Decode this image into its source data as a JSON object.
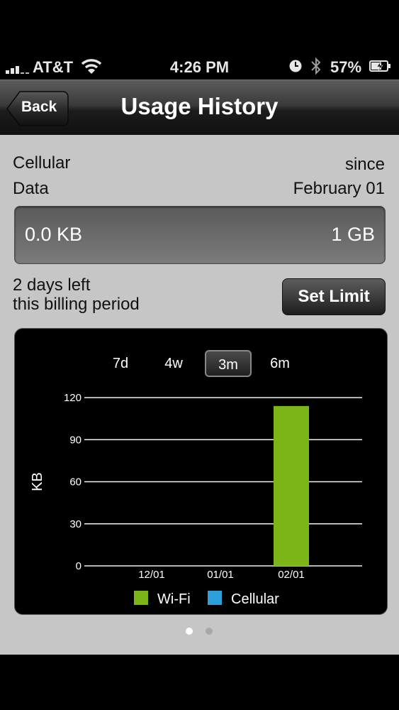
{
  "status_bar": {
    "carrier": "AT&T",
    "time": "4:26 PM",
    "battery": "57%"
  },
  "nav": {
    "back_label": "Back",
    "title": "Usage History"
  },
  "usage": {
    "type_line1": "Cellular",
    "type_line2": "Data",
    "since_line1": "since",
    "since_line2": "February 01",
    "used": "0.0 KB",
    "limit": "1 GB",
    "used_fraction": 0,
    "days_left_line1": "2 days left",
    "days_left_line2": "this billing period",
    "set_limit_label": "Set Limit"
  },
  "range_tabs": [
    {
      "label": "7d",
      "active": false
    },
    {
      "label": "4w",
      "active": false
    },
    {
      "label": "3m",
      "active": true
    },
    {
      "label": "6m",
      "active": false
    }
  ],
  "chart_data": {
    "type": "bar",
    "categories": [
      "12/01",
      "01/01",
      "02/01"
    ],
    "series": [
      {
        "name": "Wi-Fi",
        "color": "#7cb518",
        "values": [
          0,
          0,
          114
        ]
      },
      {
        "name": "Cellular",
        "color": "#2e9fd8",
        "values": [
          0,
          0,
          0
        ]
      }
    ],
    "ylabel": "KB",
    "ylim": [
      0,
      120
    ],
    "yticks": [
      0,
      30,
      60,
      90,
      120
    ],
    "grid": true,
    "legend": "bottom"
  },
  "page_indicator": {
    "count": 2,
    "current": 0
  }
}
